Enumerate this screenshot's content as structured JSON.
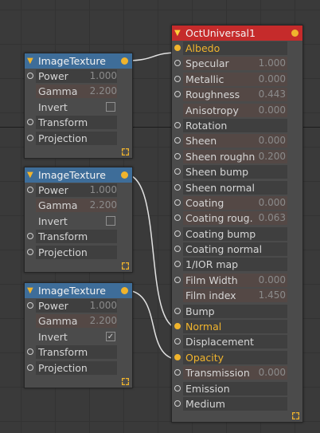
{
  "image_texture_nodes": [
    {
      "title": "ImageTexture",
      "rows": [
        {
          "label": "Power",
          "value": "1.000"
        },
        {
          "label": "Gamma",
          "value": "2.200"
        },
        {
          "label": "Invert",
          "checked": false
        },
        {
          "label": "Transform"
        },
        {
          "label": "Projection"
        }
      ]
    },
    {
      "title": "ImageTexture",
      "rows": [
        {
          "label": "Power",
          "value": "1.000"
        },
        {
          "label": "Gamma",
          "value": "2.200"
        },
        {
          "label": "Invert",
          "checked": false
        },
        {
          "label": "Transform"
        },
        {
          "label": "Projection"
        }
      ]
    },
    {
      "title": "ImageTexture",
      "rows": [
        {
          "label": "Power",
          "value": "1.000"
        },
        {
          "label": "Gamma",
          "value": "2.200"
        },
        {
          "label": "Invert",
          "checked": true
        },
        {
          "label": "Transform"
        },
        {
          "label": "Projection"
        }
      ]
    }
  ],
  "oct_node": {
    "title": "OctUniversal1",
    "rows": [
      {
        "label": "Albedo",
        "connected": true
      },
      {
        "label": "Specular",
        "value": "1.000"
      },
      {
        "label": "Metallic",
        "value": "0.000"
      },
      {
        "label": "Roughness",
        "value": "0.443"
      },
      {
        "label": "Anisotropy",
        "value": "0.000"
      },
      {
        "label": "Rotation"
      },
      {
        "label": "Sheen",
        "value": "0.000"
      },
      {
        "label": "Sheen roughn",
        "value": "0.200"
      },
      {
        "label": "Sheen bump"
      },
      {
        "label": "Sheen normal"
      },
      {
        "label": "Coating",
        "value": "0.000"
      },
      {
        "label": "Coating roug.",
        "value": "0.063"
      },
      {
        "label": "Coating bump"
      },
      {
        "label": "Coating normal"
      },
      {
        "label": "1/IOR map"
      },
      {
        "label": "Film Width",
        "value": "0.000"
      },
      {
        "label": "Film index",
        "value": "1.450"
      },
      {
        "label": "Bump"
      },
      {
        "label": "Normal",
        "connected": true
      },
      {
        "label": "Displacement"
      },
      {
        "label": "Opacity",
        "connected": true
      },
      {
        "label": "Transmission",
        "value": "0.000"
      },
      {
        "label": "Emission"
      },
      {
        "label": "Medium"
      }
    ]
  },
  "colors": {
    "canvas": "#3a3a3a",
    "node_body": "#4b4b4b",
    "texture_header": "#3e6d99",
    "material_header": "#c52b2b",
    "connection": "#f0b42d",
    "wire": "#e2e2e2"
  }
}
